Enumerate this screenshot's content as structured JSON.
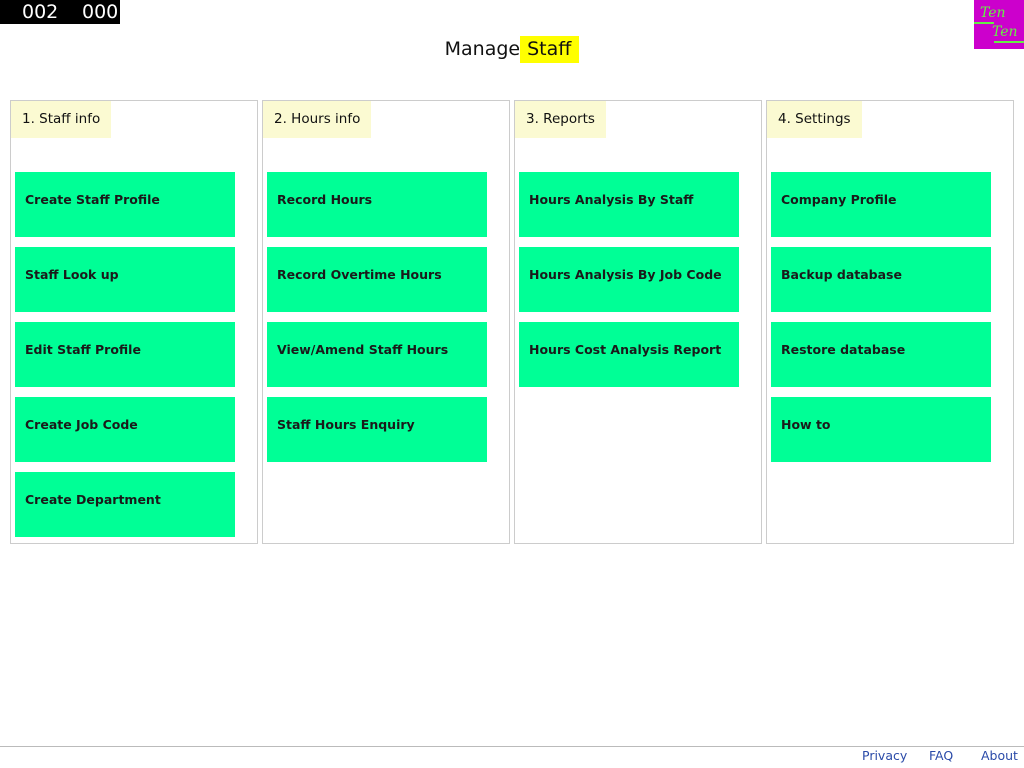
{
  "counter": {
    "left": "002",
    "right": "000"
  },
  "logo": {
    "line1": "Ten",
    "line2": "Ten",
    "bg_color": "#cc00cc",
    "fg_color": "#66ee44"
  },
  "title": {
    "prefix": "Manage",
    "highlight": "Staff",
    "highlight_color": "#ffff00"
  },
  "colors": {
    "tile": "#00ff96",
    "panel_header": "#fbfad2",
    "link": "#2a4aa8"
  },
  "panels": [
    {
      "header": "1. Staff info",
      "tiles": [
        "Create Staff Profile",
        "Staff Look up",
        "Edit Staff Profile",
        "Create Job Code",
        "Create Department"
      ]
    },
    {
      "header": "2. Hours info",
      "tiles": [
        "Record Hours",
        "Record Overtime Hours",
        "View/Amend Staff Hours",
        "Staff Hours Enquiry"
      ]
    },
    {
      "header": "3. Reports",
      "tiles": [
        "Hours Analysis By Staff",
        "Hours Analysis By Job Code",
        "Hours Cost Analysis Report"
      ]
    },
    {
      "header": "4. Settings",
      "tiles": [
        "Company Profile",
        "Backup database",
        "Restore database",
        "How to"
      ]
    }
  ],
  "footer": {
    "privacy": "Privacy",
    "faq": "FAQ",
    "about": "About"
  }
}
